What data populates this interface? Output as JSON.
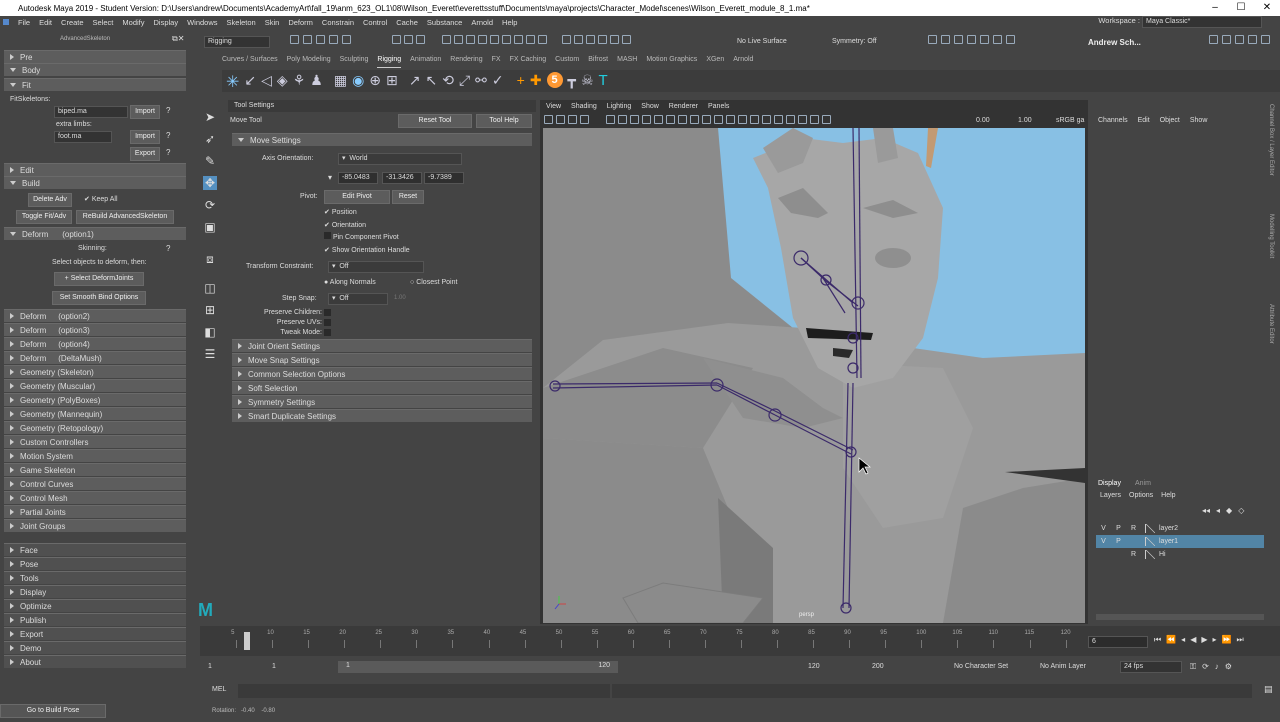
{
  "window": {
    "title": "Autodesk Maya 2019 - Student Version: D:\\Users\\andrew\\Documents\\AcademyArt\\fall_19\\anm_623_OL1\\08\\Wilson_Everett\\everettsstuff\\Documents\\maya\\projects\\Character_Model\\scenes\\Wilson_Everett_module_8_1.ma*"
  },
  "menu": [
    "File",
    "Edit",
    "Create",
    "Select",
    "Modify",
    "Display",
    "Windows",
    "Skeleton",
    "Skin",
    "Deform",
    "Constrain",
    "Control",
    "Cache",
    "Substance",
    "Arnold",
    "Help"
  ],
  "workspace": {
    "label": "Workspace :",
    "value": "Maya Classic*"
  },
  "toolbar": {
    "mode": "Rigging",
    "live": "No Live Surface",
    "symmetry": "Symmetry: Off",
    "user": "Andrew Sch..."
  },
  "shelf_tabs": [
    "Curves / Surfaces",
    "Poly Modeling",
    "Sculpting",
    "Rigging",
    "Animation",
    "Rendering",
    "FX",
    "FX Caching",
    "Custom",
    "Bifrost",
    "MASH",
    "Motion Graphics",
    "XGen",
    "Arnold"
  ],
  "adv": {
    "title": "AdvancedSkeleton",
    "pre": "Pre",
    "body": "Body",
    "fit": "Fit",
    "fitskel": "FitSkeletons:",
    "biped": "biped.ma",
    "import": "Import",
    "extra": "extra limbs:",
    "foot": "foot.ma",
    "export": "Export",
    "q": "?",
    "edit": "Edit",
    "build": "Build",
    "delete_adv": "Delete Adv",
    "keep_all": "Keep All",
    "toggle": "Toggle Fit/Adv",
    "rebuild": "ReBuild AdvancedSkeleton",
    "deform": "Deform",
    "opt1": "(option1)",
    "skinning": "Skinning:",
    "select_msg": "Select objects to deform, then:",
    "select_deform": "+ Select DeformJoints",
    "smooth": "Set Smooth Bind Options",
    "items": [
      [
        "Deform",
        "(option2)"
      ],
      [
        "Deform",
        "(option3)"
      ],
      [
        "Deform",
        "(option4)"
      ],
      [
        "Deform",
        "(DeltaMush)"
      ],
      [
        "Geometry (Skeleton)",
        ""
      ],
      [
        "Geometry (Muscular)",
        ""
      ],
      [
        "Geometry (PolyBoxes)",
        ""
      ],
      [
        "Geometry (Mannequin)",
        ""
      ],
      [
        "Geometry (Retopology)",
        ""
      ],
      [
        "Custom Controllers",
        ""
      ],
      [
        "Motion System",
        ""
      ],
      [
        "Game Skeleton",
        ""
      ],
      [
        "Control Curves",
        ""
      ],
      [
        "Control Mesh",
        ""
      ],
      [
        "Partial Joints",
        ""
      ],
      [
        "Joint Groups",
        ""
      ]
    ],
    "bottom": [
      "Face",
      "Pose",
      "Tools",
      "Display",
      "Optimize",
      "Publish",
      "Export",
      "Demo",
      "About"
    ],
    "go_build": "Go to Build Pose"
  },
  "tool": {
    "header": "Tool Settings",
    "name": "Move Tool",
    "reset": "Reset Tool",
    "help": "Tool Help",
    "move_settings": "Move Settings",
    "axis_label": "Axis Orientation:",
    "axis_value": "World",
    "v1": "-85.0483",
    "v2": "-31.3426",
    "v3": "-9.7389",
    "pivot": "Pivot:",
    "edit_pivot": "Edit Pivot",
    "reset_btn": "Reset",
    "position": "Position",
    "orientation": "Orientation",
    "pin": "Pin Component Pivot",
    "show_handle": "Show Orientation Handle",
    "constraint": "Transform Constraint:",
    "off": "Off",
    "along": "Along Normals",
    "closest": "Closest Point",
    "step": "Step Snap:",
    "step_val": "1.00",
    "preserve_children": "Preserve Children:",
    "preserve_uvs": "Preserve UVs:",
    "tweak": "Tweak Mode:",
    "sections": [
      "Joint Orient Settings",
      "Move Snap Settings",
      "Common Selection Options",
      "Soft Selection",
      "Symmetry Settings",
      "Smart Duplicate Settings"
    ]
  },
  "viewport": {
    "menu": [
      "View",
      "Shading",
      "Lighting",
      "Show",
      "Renderer",
      "Panels"
    ],
    "v1": "0.00",
    "v2": "1.00",
    "cs": "sRGB ga",
    "cam": "persp"
  },
  "channels": {
    "menu": [
      "Channels",
      "Edit",
      "Object",
      "Show"
    ],
    "tabs": [
      "Display",
      "Anim"
    ],
    "menu2": [
      "Layers",
      "Options",
      "Help"
    ],
    "layers": [
      {
        "v": "V",
        "p": "P",
        "r": "R",
        "name": "layer2",
        "sel": false
      },
      {
        "v": "V",
        "p": "P",
        "r": "",
        "name": "layer1",
        "sel": true
      },
      {
        "v": "",
        "p": "",
        "r": "R",
        "name": "Hi",
        "sel": false
      }
    ],
    "side": [
      "Channel Box / Layer Editor",
      "Modelling Toolkit",
      "Attribute Editor"
    ]
  },
  "timeline": {
    "ticks": [
      "5",
      "10",
      "15",
      "20",
      "25",
      "30",
      "35",
      "40",
      "45",
      "50",
      "55",
      "60",
      "65",
      "70",
      "75",
      "80",
      "85",
      "90",
      "95",
      "100",
      "105",
      "110",
      "115",
      "120"
    ],
    "current": "6"
  },
  "range": {
    "start": "1",
    "start2": "1",
    "slider_l": "1",
    "slider_r": "120",
    "end": "120",
    "end2": "200",
    "char": "No Character Set",
    "anim": "No Anim Layer",
    "fps": "24 fps"
  },
  "cmd": {
    "label": "MEL"
  },
  "help": {
    "text": "Rotation:   -0.40    -0.80"
  }
}
